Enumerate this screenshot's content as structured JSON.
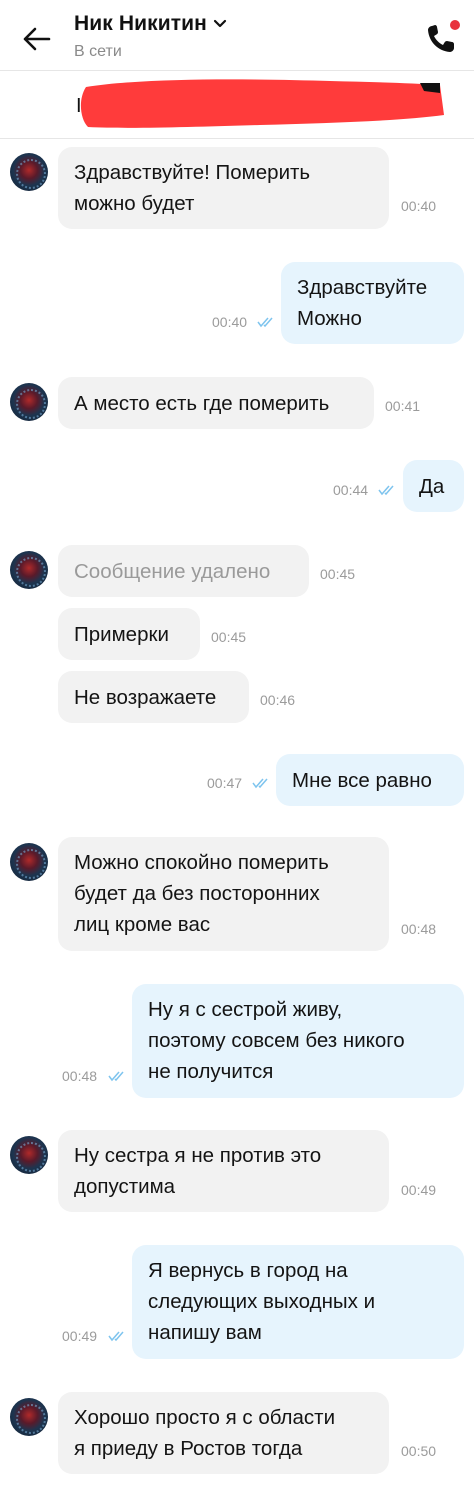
{
  "header": {
    "contact_name": "Ник Никитин",
    "status": "В сети"
  },
  "listing": {
    "visible_letter": "I"
  },
  "colors": {
    "incoming_bubble": "#f2f2f2",
    "outgoing_bubble": "#e6f4fd",
    "read_ticks": "#7ec4ee",
    "call_badge": "#e8313c",
    "redaction": "#ff3b3b"
  },
  "messages": [
    {
      "direction": "in",
      "text": "Здравствуйте! Померить\nможно будет",
      "time": "00:40"
    },
    {
      "direction": "out",
      "text": "Здравствуйте\nМожно",
      "time": "00:40",
      "read": true
    },
    {
      "direction": "in",
      "text": "А место есть где померить",
      "time": "00:41"
    },
    {
      "direction": "out",
      "text": "Да",
      "time": "00:44",
      "read": true
    },
    {
      "direction": "in",
      "text": "Сообщение удалено",
      "time": "00:45",
      "deleted": true
    },
    {
      "direction": "in",
      "text": "Примерки",
      "time": "00:45"
    },
    {
      "direction": "in",
      "text": "Не возражаете",
      "time": "00:46"
    },
    {
      "direction": "out",
      "text": "Мне все равно",
      "time": "00:47",
      "read": true
    },
    {
      "direction": "in",
      "text": "Можно спокойно померить\nбудет да без посторонних\nлиц кроме вас",
      "time": "00:48"
    },
    {
      "direction": "out",
      "text": "Ну я с сестрой живу,\nпоэтому совсем без никого\nне получится",
      "time": "00:48",
      "read": true
    },
    {
      "direction": "in",
      "text": "Ну сестра я не против это\nдопустима",
      "time": "00:49"
    },
    {
      "direction": "out",
      "text": "Я вернусь в город на\nследующих выходных и\nнапишу вам",
      "time": "00:49",
      "read": true
    },
    {
      "direction": "in",
      "text": "Хорошо просто я с области\nя приеду в Ростов тогда",
      "time": "00:50"
    }
  ]
}
